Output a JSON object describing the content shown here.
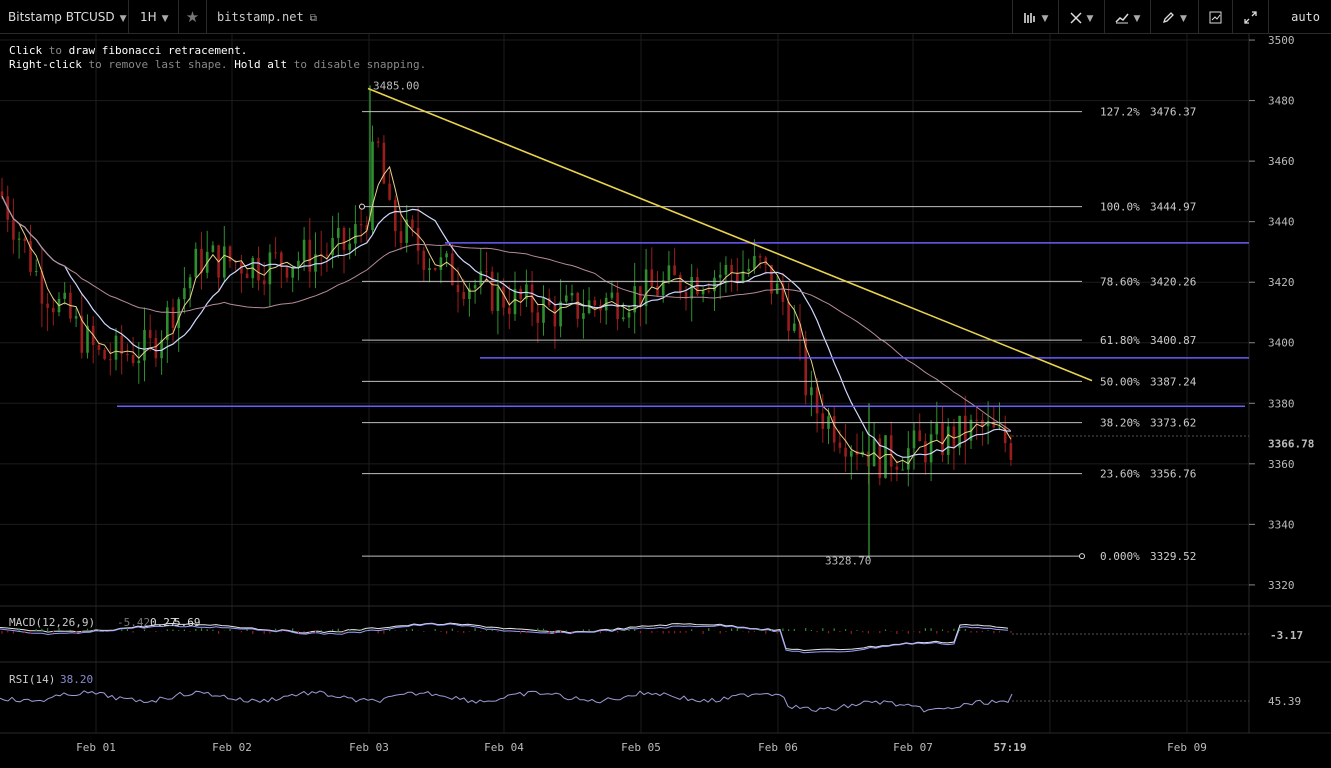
{
  "toolbar": {
    "symbol": "Bitstamp BTCUSD",
    "interval": "1H",
    "site": "bitstamp.net",
    "scale_mode": "auto"
  },
  "hint": {
    "line1_key": "Click",
    "line1_mid": "to",
    "line1_action": "draw fibonacci retracement.",
    "line2_key": "Right-click",
    "line2_mid": "to remove last shape.",
    "line2_key2": "Hold alt",
    "line2_end": "to disable snapping."
  },
  "icons": {
    "star": "star-icon",
    "external": "external-link-icon",
    "bars": "bar-style-icon",
    "crosshair": "crosshair-icon",
    "chart_type": "chart-type-icon",
    "pencil": "pencil-icon",
    "indicator": "indicator-icon",
    "fullscreen": "fullscreen-icon"
  },
  "colors": {
    "background": "#000000",
    "grid": "#1c1c1c",
    "candle_up": "#2f8f2f",
    "candle_down": "#9a1d1d",
    "trendline": "#e8d44d",
    "horizontal_lines": "#6b5cff",
    "fib_lines": "#bfbfbf",
    "ma_fast": "#e8d38a",
    "ma_slow": "#cfd8ff",
    "ma_long": "#b48a9a",
    "rsi": "#9d9dd9"
  },
  "price_axis": {
    "ticks": [
      "3500",
      "3480",
      "3460",
      "3440",
      "3420",
      "3400",
      "3380",
      "3360",
      "3340",
      "3320"
    ],
    "last_price": "3366.78",
    "min": 3316,
    "max": 3502
  },
  "time_axis": {
    "ticks": [
      "Feb 01",
      "Feb 02",
      "Feb 03",
      "Feb 04",
      "Feb 05",
      "Feb 06",
      "Feb 07",
      "Feb 09"
    ],
    "countdown": "57:19"
  },
  "fib_levels": [
    {
      "pct": "127.2%",
      "price": "3476.37"
    },
    {
      "pct": "100.0%",
      "price": "3444.97"
    },
    {
      "pct": "78.60%",
      "price": "3420.26"
    },
    {
      "pct": "61.80%",
      "price": "3400.87"
    },
    {
      "pct": "50.00%",
      "price": "3387.24"
    },
    {
      "pct": "38.20%",
      "price": "3373.62"
    },
    {
      "pct": "23.60%",
      "price": "3356.76"
    },
    {
      "pct": "0.000%",
      "price": "3329.52"
    }
  ],
  "price_labels": {
    "high": "3485.00",
    "low": "3328.70"
  },
  "macd": {
    "label": "MACD(12,26,9)",
    "v1": "-5.42",
    "v2": "0.27",
    "v3": "5.69",
    "axis_value": "-3.17"
  },
  "rsi": {
    "label": "RSI(14)",
    "value": "38.20",
    "axis_value": "45.39"
  }
}
